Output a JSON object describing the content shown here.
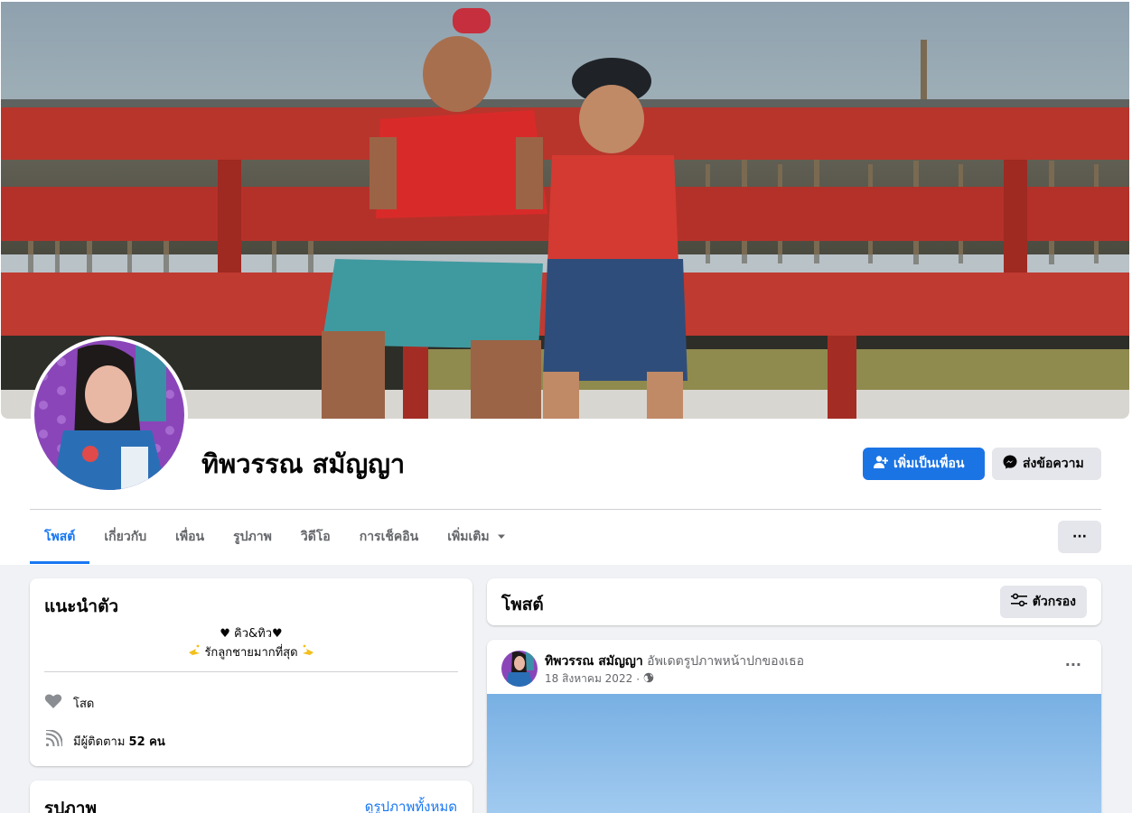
{
  "profile": {
    "name": "ทิพวรรณ สมัญญา"
  },
  "actions": {
    "add_friend": "เพิ่มเป็นเพื่อน",
    "message": "ส่งข้อความ"
  },
  "tabs": [
    {
      "label": "โพสต์",
      "active": true
    },
    {
      "label": "เกี่ยวกับ"
    },
    {
      "label": "เพื่อน"
    },
    {
      "label": "รูปภาพ"
    },
    {
      "label": "วิดีโอ"
    },
    {
      "label": "การเช็คอิน"
    },
    {
      "label": "เพิ่มเติม"
    }
  ],
  "more_menu_label": "···",
  "intro": {
    "title": "แนะนำตัว",
    "bio_line1": "♥ คิว&ทิว♥",
    "bio_line2": "รักลูกชายมากที่สุด",
    "relationship": "โสด",
    "followers_prefix": "มีผู้ติดตาม",
    "followers_count": "52 คน"
  },
  "photos": {
    "title": "รูปภาพ",
    "see_all": "ดูรูปภาพทั้งหมด"
  },
  "posts": {
    "title": "โพสต์",
    "filter": "ตัวกรอง"
  },
  "post": {
    "author": "ทิพวรรณ สมัญญา",
    "action": "อัพเดตรูปภาพหน้าปกของเธอ",
    "date": "18 สิงหาคม 2022",
    "separator": "·",
    "menu": "···"
  },
  "colors": {
    "primary": "#1b74e4",
    "link": "#1877f2",
    "page_bg": "#f0f2f5",
    "secondary_button": "#e4e6eb"
  },
  "icons": {
    "add_friend": "person-plus-icon",
    "message": "messenger-icon",
    "dropdown": "caret-down-icon",
    "relationship": "heart-icon",
    "followers": "rss-icon",
    "filter": "sliders-icon",
    "privacy": "globe-icon"
  }
}
